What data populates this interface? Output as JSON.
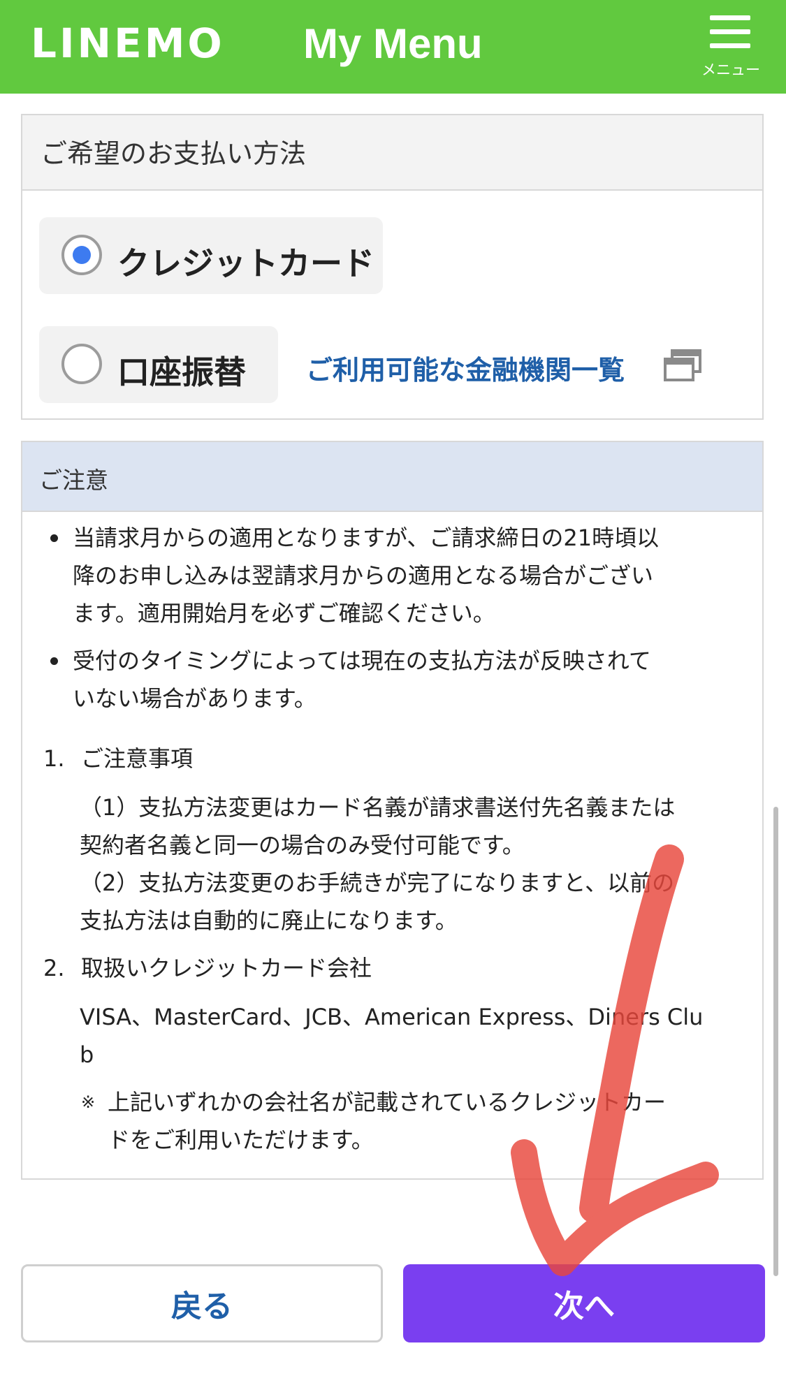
{
  "header": {
    "logo": "LINEMO",
    "title": "My Menu",
    "menu_label": "メニュー"
  },
  "payment": {
    "heading": "ご希望のお支払い方法",
    "options": [
      {
        "label": "クレジットカード",
        "selected": true
      },
      {
        "label": "口座振替",
        "selected": false
      }
    ],
    "bank_link": "ご利用可能な金融機関一覧"
  },
  "notice": {
    "heading": "ご注意",
    "bullets": [
      [
        "当請求月からの適用となりますが、ご請求締日の21時頃以",
        "降のお申し込みは翌請求月からの適用となる場合がござい",
        "ます。適用開始月を必ずご確認ください。"
      ],
      [
        "受付のタイミングによっては現在の支払方法が反映されて",
        "いない場合があります。"
      ]
    ],
    "items": [
      {
        "number": "1.",
        "title": "ご注意事項",
        "lines": [
          "（1）支払方法変更はカード名義が請求書送付先名義または",
          "契約者名義と同一の場合のみ受付可能です。",
          "（2）支払方法変更のお手続きが完了になりますと、以前の",
          "支払方法は自動的に廃止になります。"
        ]
      },
      {
        "number": "2.",
        "title": "取扱いクレジットカード会社",
        "lines": [
          "VISA、MasterCard、JCB、American Express、Diners Clu",
          "b"
        ],
        "note_mark": "※",
        "note_lines": [
          "上記いずれかの会社名が記載されているクレジットカー",
          "ドをご利用いただけます。"
        ]
      }
    ]
  },
  "buttons": {
    "back": "戻る",
    "next": "次へ"
  },
  "colors": {
    "header": "#61c93f",
    "next_button": "#7a3ff0",
    "link": "#1f5fa8",
    "radio_selected": "#3d7bf0",
    "annotation_arrow": "#e8473c"
  }
}
